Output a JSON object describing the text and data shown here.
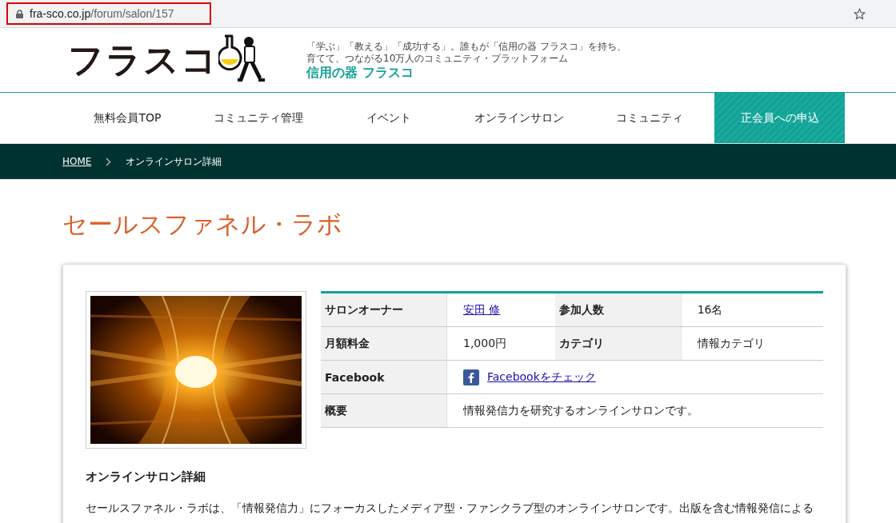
{
  "browser": {
    "url_host": "fra-sco.co.jp",
    "url_path": "/forum/salon/157"
  },
  "header": {
    "logo": "フラスコ",
    "tagline": "「学ぶ」「教える」「成功する」。誰もが「信用の器 フラスコ」を持ち、育てて、つながる10万人のコミュニティ・プラットフォーム",
    "brand": "信用の器 フラスコ"
  },
  "nav": [
    {
      "label": "無料会員TOP",
      "kind": "link"
    },
    {
      "label": "コミュニティ管理",
      "kind": "link"
    },
    {
      "label": "イベント",
      "kind": "link"
    },
    {
      "label": "オンラインサロン",
      "kind": "link"
    },
    {
      "label": "コミュニティ",
      "kind": "link"
    },
    {
      "label": "正会員への申込",
      "kind": "cta"
    }
  ],
  "breadcrumb": [
    {
      "label": "HOME",
      "kind": "link"
    },
    {
      "label": "オンラインサロン詳細",
      "kind": "current"
    }
  ],
  "title": "セールスファネル・ラボ",
  "salon": {
    "rows": [
      {
        "cells": [
          {
            "kind": "head",
            "text": "サロンオーナー"
          },
          {
            "kind": "link",
            "text": "安田 修"
          },
          {
            "kind": "head",
            "text": "参加人数"
          },
          {
            "kind": "text",
            "text": "16名"
          }
        ]
      },
      {
        "cells": [
          {
            "kind": "head",
            "text": "月額料金"
          },
          {
            "kind": "text",
            "text": "1,000円"
          },
          {
            "kind": "head",
            "text": "カテゴリ"
          },
          {
            "kind": "text",
            "text": "情報カテゴリ"
          }
        ]
      },
      {
        "cells": [
          {
            "kind": "head",
            "text": "Facebook"
          },
          {
            "kind": "facebook",
            "text": "Facebookをチェック",
            "colspan": 3
          }
        ]
      },
      {
        "cells": [
          {
            "kind": "head",
            "text": "概要"
          },
          {
            "kind": "text",
            "text": "情報発信力を研究するオンラインサロンです。",
            "colspan": 3
          }
        ]
      }
    ],
    "detail_heading": "オンラインサロン詳細",
    "detail_text": "セールスファネル・ラボは、「情報発信力」にフォーカスしたメディア型・ファンクラブ型のオンラインサロンです。出版を含む情報発信による"
  }
}
